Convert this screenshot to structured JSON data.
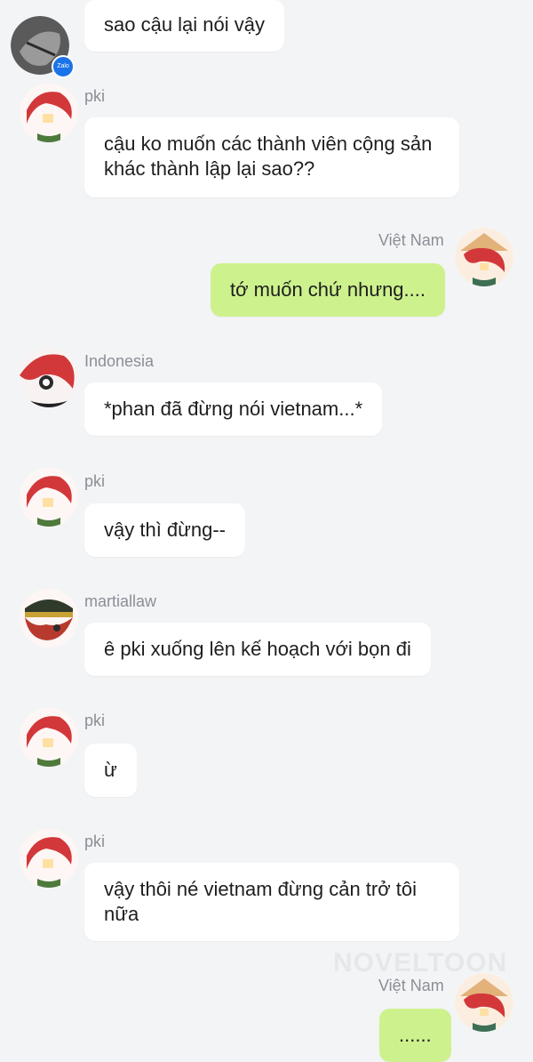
{
  "watermark": "NOVELTOON",
  "badge_label": "Zalo",
  "messages": [
    {
      "sender": "",
      "text": "sao cậu lại nói vậy",
      "mine": false,
      "avatar": "zalo-avatar"
    },
    {
      "sender": "pki",
      "text": "cậu ko muốn các thành viên cộng sản khác thành lập lại sao??",
      "mine": false,
      "avatar": "pki-avatar"
    },
    {
      "sender": "Việt Nam",
      "text": "tớ muốn chứ nhưng....",
      "mine": true,
      "avatar": "vietnam-avatar"
    },
    {
      "sender": "Indonesia",
      "text": "*phan đã đừng nói vietnam...*",
      "mine": false,
      "avatar": "indonesia-avatar"
    },
    {
      "sender": "pki",
      "text": "vậy thì đừng--",
      "mine": false,
      "avatar": "pki-avatar"
    },
    {
      "sender": "martiallaw",
      "text": "ê pki xuống lên kế hoạch với bọn đi",
      "mine": false,
      "avatar": "martiallaw-avatar"
    },
    {
      "sender": "pki",
      "text": "ừ",
      "mine": false,
      "avatar": "pki-avatar"
    },
    {
      "sender": "pki",
      "text": "vậy thôi né vietnam đừng cản trở tôi nữa",
      "mine": false,
      "avatar": "pki-avatar"
    },
    {
      "sender": "Việt Nam",
      "text": "......",
      "mine": true,
      "avatar": "vietnam-avatar"
    }
  ],
  "colors": {
    "background": "#f3f4f6",
    "bubble_other": "#ffffff",
    "bubble_mine": "#cdf28d",
    "sender_text": "#8a8f96"
  }
}
